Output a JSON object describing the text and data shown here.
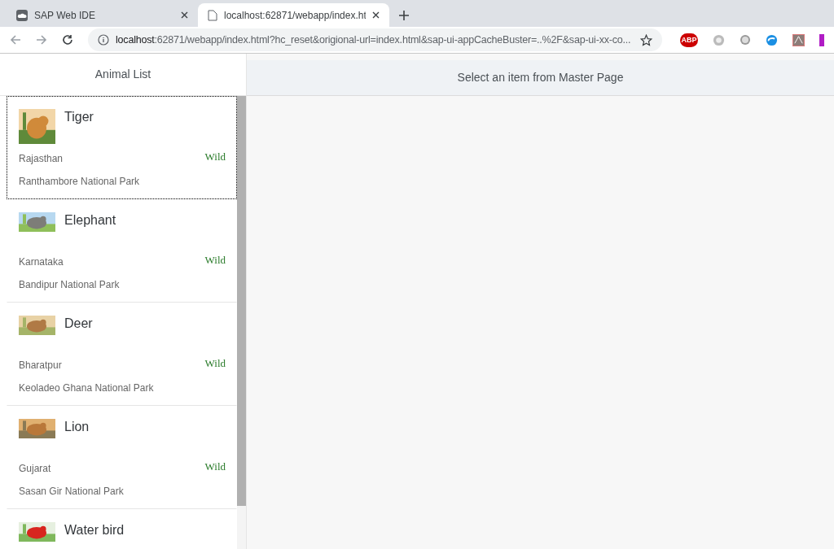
{
  "browser": {
    "tabs": [
      {
        "title": "SAP Web IDE",
        "selected": false
      },
      {
        "title": "localhost:62871/webapp/index.ht",
        "selected": true
      }
    ],
    "url_host": "localhost",
    "url_rest": ":62871/webapp/index.html?hc_reset&origional-url=index.html&sap-ui-appCacheBuster=..%2F&sap-ui-xx-co...",
    "extension_badge": "ABP"
  },
  "master": {
    "title": "Animal List",
    "items": [
      {
        "name": "Tiger",
        "state": "Rajasthan",
        "park": "Ranthambore National Park",
        "status": "Wild",
        "focused": true
      },
      {
        "name": "Elephant",
        "state": "Karnataka",
        "park": "Bandipur National Park",
        "status": "Wild",
        "focused": false
      },
      {
        "name": "Deer",
        "state": "Bharatpur",
        "park": "Keoladeo Ghana National Park",
        "status": "Wild",
        "focused": false
      },
      {
        "name": "Lion",
        "state": "Gujarat",
        "park": "Sasan Gir National Park",
        "status": "Wild",
        "focused": false
      },
      {
        "name": "Water bird",
        "focused": false
      }
    ]
  },
  "detail": {
    "title": "Select an item from Master Page"
  }
}
